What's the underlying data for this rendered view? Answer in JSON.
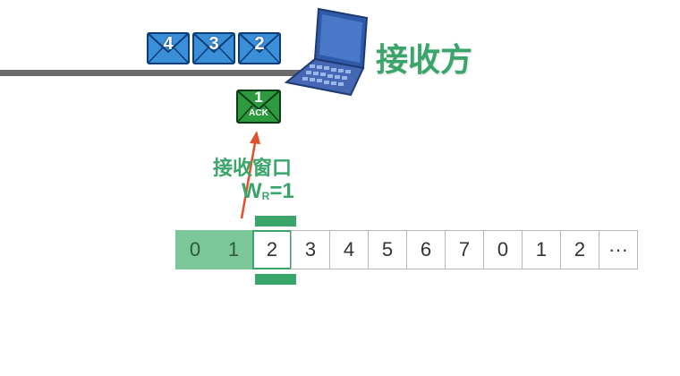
{
  "colors": {
    "accent_green": "#3aa56a",
    "envelope_blue": "#3b8ed8",
    "ack_green": "#2e9a3f",
    "arrow_red": "#e0502c",
    "received_cell": "#7cc79a"
  },
  "packets": [
    {
      "number": "4",
      "icon": "envelope-icon"
    },
    {
      "number": "3",
      "icon": "envelope-icon"
    },
    {
      "number": "2",
      "icon": "envelope-icon"
    }
  ],
  "ack": {
    "number": "1",
    "label": "ACK",
    "icon": "envelope-icon"
  },
  "receiver": {
    "label": "接收方",
    "icon": "laptop-icon"
  },
  "window": {
    "title": "接收窗口",
    "eq_prefix": "W",
    "eq_sub": "R",
    "eq_suffix": "=1"
  },
  "sequence": [
    {
      "label": "0",
      "state": "received"
    },
    {
      "label": "1",
      "state": "received"
    },
    {
      "label": "2",
      "state": "window"
    },
    {
      "label": "3",
      "state": "normal"
    },
    {
      "label": "4",
      "state": "normal"
    },
    {
      "label": "5",
      "state": "normal"
    },
    {
      "label": "6",
      "state": "normal"
    },
    {
      "label": "7",
      "state": "normal"
    },
    {
      "label": "0",
      "state": "normal"
    },
    {
      "label": "1",
      "state": "normal"
    },
    {
      "label": "2",
      "state": "normal"
    },
    {
      "label": "···",
      "state": "normal"
    }
  ]
}
